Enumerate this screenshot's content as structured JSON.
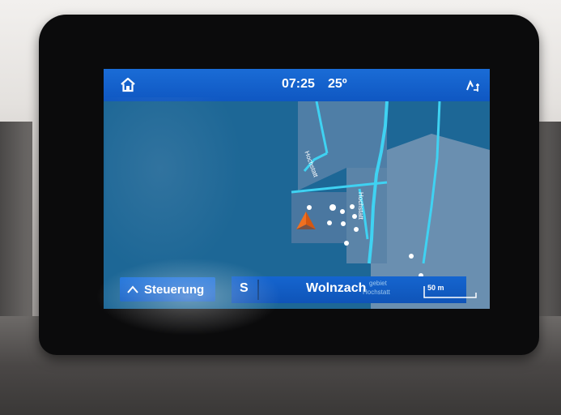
{
  "status_bar": {
    "home_icon": "home-icon",
    "time": "07:25",
    "temperature": "25º",
    "signal_icon": "signal-icon"
  },
  "map": {
    "street_labels": [
      "Hochstatt",
      "Hochstatt"
    ],
    "faded_labels": [
      "gebiet",
      "Hochstatt"
    ]
  },
  "bottom_bar": {
    "control_button": "Steuerung",
    "direction": "S",
    "street": "Wolnzach",
    "scale": "50 m"
  },
  "colors": {
    "topbar": "#0f57c2",
    "map_water": "#1f6a99",
    "road": "#3fd2f2",
    "land": "#5a7ea0",
    "accent_orange": "#f07020"
  }
}
